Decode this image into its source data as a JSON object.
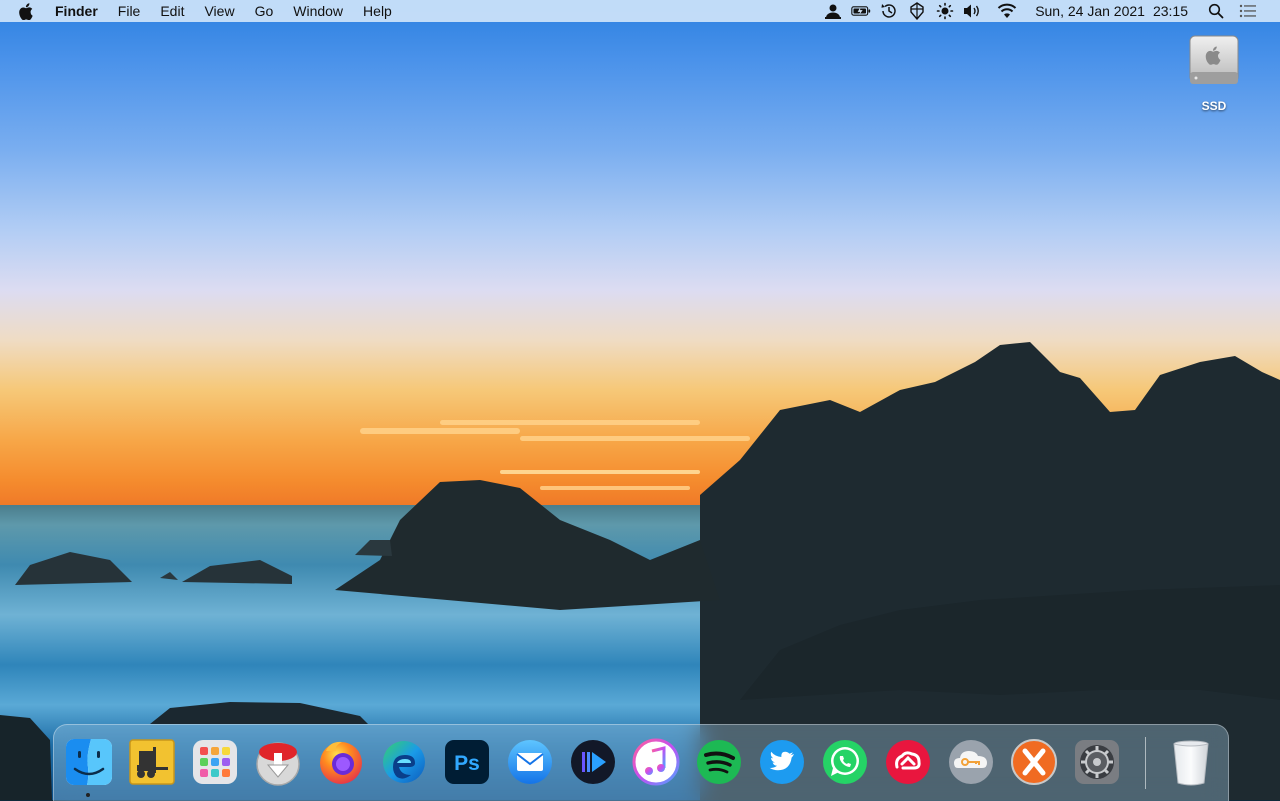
{
  "menubar": {
    "app_name": "Finder",
    "menus": [
      "File",
      "Edit",
      "View",
      "Go",
      "Window",
      "Help"
    ],
    "status_icons": [
      "user-icon",
      "battery-charging-icon",
      "time-machine-icon",
      "vpn-icon",
      "brightness-icon",
      "volume-icon",
      "wifi-icon"
    ],
    "date": "Sun, 24 Jan 2021",
    "time": "23:15"
  },
  "desktop": {
    "drive_label": "SSD"
  },
  "dock": {
    "apps": [
      "finder",
      "forklift",
      "launchpad",
      "transmit",
      "firefox",
      "edge",
      "photoshop",
      "mail",
      "infuse",
      "itunes",
      "spotify",
      "twitter",
      "whatsapp",
      "creative-cloud",
      "cloud-app",
      "crossover",
      "system-preferences"
    ],
    "trash": "trash"
  },
  "colors": {
    "menubar_bg": "#d6e8fa",
    "dock_bg": "#aad2eb"
  }
}
